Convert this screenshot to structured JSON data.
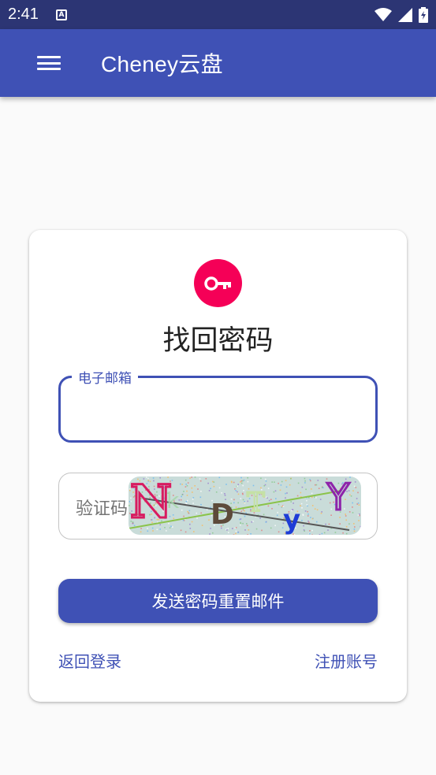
{
  "status_bar": {
    "time": "2:41"
  },
  "app_bar": {
    "title": "Cheney云盘"
  },
  "card": {
    "title": "找回密码",
    "email_field": {
      "label": "电子邮箱",
      "value": ""
    },
    "captcha_field": {
      "placeholder": "验证码",
      "captcha_text": "NkDTyY"
    },
    "submit_label": "发送密码重置邮件",
    "back_to_login": "返回登录",
    "register": "注册账号"
  },
  "colors": {
    "primary": "#3f51b5",
    "accent": "#f50057",
    "status_bar": "#2c3574"
  }
}
